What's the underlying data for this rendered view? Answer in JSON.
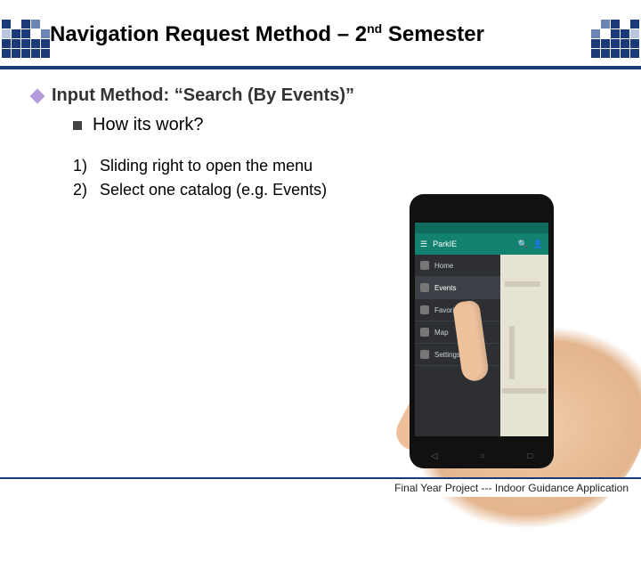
{
  "title": {
    "prefix": "Navigation Request Method – 2",
    "superscript": "nd",
    "suffix": " Semester"
  },
  "section": {
    "heading": "Input Method: “Search (By Events)”",
    "subheading": "How its work?"
  },
  "steps": [
    {
      "num": "1)",
      "text": "Sliding right to open the menu"
    },
    {
      "num": "2)",
      "text": "Select one catalog (e.g. Events)"
    }
  ],
  "phone": {
    "app_title": "ParkIE",
    "drawer_items": [
      {
        "label": "Home",
        "active": false
      },
      {
        "label": "Events",
        "active": true
      },
      {
        "label": "Favorites",
        "active": false
      },
      {
        "label": "Map",
        "active": false
      },
      {
        "label": "Settings",
        "active": false
      }
    ]
  },
  "footer": "Final Year Project --- Indoor Guidance Application"
}
